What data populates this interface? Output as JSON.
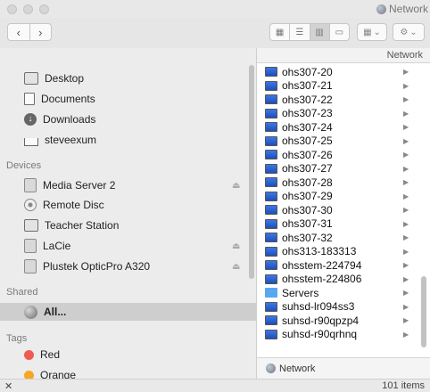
{
  "window": {
    "title": "Network",
    "title_icon": "network-globe-icon"
  },
  "toolbar": {
    "back_icon": "chevron-left-icon",
    "back_glyph": "‹",
    "forward_icon": "chevron-right-icon",
    "forward_glyph": "›",
    "view_modes": [
      "icon-view",
      "list-view",
      "column-view",
      "gallery-view"
    ],
    "active_view": "column-view",
    "arrange_icon": "arrange-grid-icon",
    "action_icon": "gear-icon"
  },
  "sidebar": {
    "favorites": [
      {
        "label": "Desktop",
        "icon": "desktop-icon"
      },
      {
        "label": "Documents",
        "icon": "documents-icon"
      },
      {
        "label": "Downloads",
        "icon": "downloads-icon"
      },
      {
        "label": "steveexum",
        "icon": "home-icon"
      }
    ],
    "devices_heading": "Devices",
    "devices": [
      {
        "label": "Media Server 2",
        "icon": "disk-icon",
        "eject": true
      },
      {
        "label": "Remote Disc",
        "icon": "disc-icon",
        "eject": false
      },
      {
        "label": "Teacher Station",
        "icon": "computer-icon",
        "eject": false
      },
      {
        "label": "LaCie",
        "icon": "disk-icon",
        "eject": true
      },
      {
        "label": "Plustek OpticPro A320",
        "icon": "scanner-icon",
        "eject": true
      }
    ],
    "shared_heading": "Shared",
    "shared": [
      {
        "label": "All...",
        "icon": "network-globe-icon",
        "selected": true
      }
    ],
    "tags_heading": "Tags",
    "tags": [
      {
        "label": "Red",
        "color": "#f05a50"
      },
      {
        "label": "Orange",
        "color": "#f5a623"
      }
    ]
  },
  "column": {
    "header": "Network",
    "items": [
      {
        "name": "ohs307-20",
        "kind": "computer"
      },
      {
        "name": "ohs307-21",
        "kind": "computer"
      },
      {
        "name": "ohs307-22",
        "kind": "computer"
      },
      {
        "name": "ohs307-23",
        "kind": "computer"
      },
      {
        "name": "ohs307-24",
        "kind": "computer"
      },
      {
        "name": "ohs307-25",
        "kind": "computer"
      },
      {
        "name": "ohs307-26",
        "kind": "computer"
      },
      {
        "name": "ohs307-27",
        "kind": "computer"
      },
      {
        "name": "ohs307-28",
        "kind": "computer"
      },
      {
        "name": "ohs307-29",
        "kind": "computer"
      },
      {
        "name": "ohs307-30",
        "kind": "computer"
      },
      {
        "name": "ohs307-31",
        "kind": "computer"
      },
      {
        "name": "ohs307-32",
        "kind": "computer"
      },
      {
        "name": "ohs313-183313",
        "kind": "computer"
      },
      {
        "name": "ohsstem-224794",
        "kind": "computer"
      },
      {
        "name": "ohsstem-224806",
        "kind": "computer"
      },
      {
        "name": "Servers",
        "kind": "folder"
      },
      {
        "name": "suhsd-lr094ss3",
        "kind": "computer"
      },
      {
        "name": "suhsd-r90qpzp4",
        "kind": "computer"
      },
      {
        "name": "suhsd-r90qrhnq",
        "kind": "computer"
      }
    ],
    "disclosure_glyph": "▶"
  },
  "pathbar": {
    "label": "Network",
    "icon": "network-globe-icon"
  },
  "status": {
    "count": "101 items",
    "tool_glyph": "✕"
  }
}
